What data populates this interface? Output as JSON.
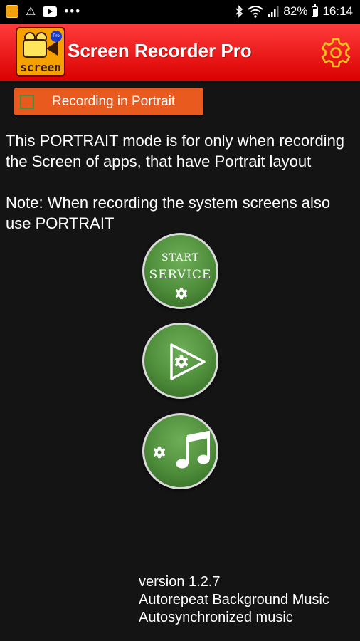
{
  "status_bar": {
    "time": "16:14",
    "battery": "82%",
    "icons": [
      "app-notification-icon",
      "warning-icon",
      "youtube-icon",
      "more-notifications-icon",
      "bluetooth-icon",
      "wifi-icon",
      "signal-icon",
      "battery-icon"
    ]
  },
  "app_bar": {
    "title": "Screen Recorder Pro",
    "logo_text": "screen",
    "logo_badge": "Pro",
    "settings_icon": "gear-icon",
    "accent_color": "#ff2a2a",
    "icon_color": "#f7c21b"
  },
  "portrait_toggle": {
    "label": "Recording in Portrait",
    "checked": false,
    "color": "#e85a1e"
  },
  "description": "This PORTRAIT mode is for only when recording the Screen of apps, that have Portrait layout\n\nNote: When recording the system screens also use PORTRAIT",
  "buttons": {
    "start_line1": "START",
    "start_line2": "SERVICE",
    "start_icon": "gear-icon",
    "record_icon": "play-gear-icon",
    "music_icons": [
      "gear-icon",
      "music-note-icon"
    ],
    "color": "#4e8d3a"
  },
  "footer": {
    "version": "version 1.2.7",
    "line2": "Autorepeat Background Music",
    "line3": "Autosynchronized music"
  }
}
